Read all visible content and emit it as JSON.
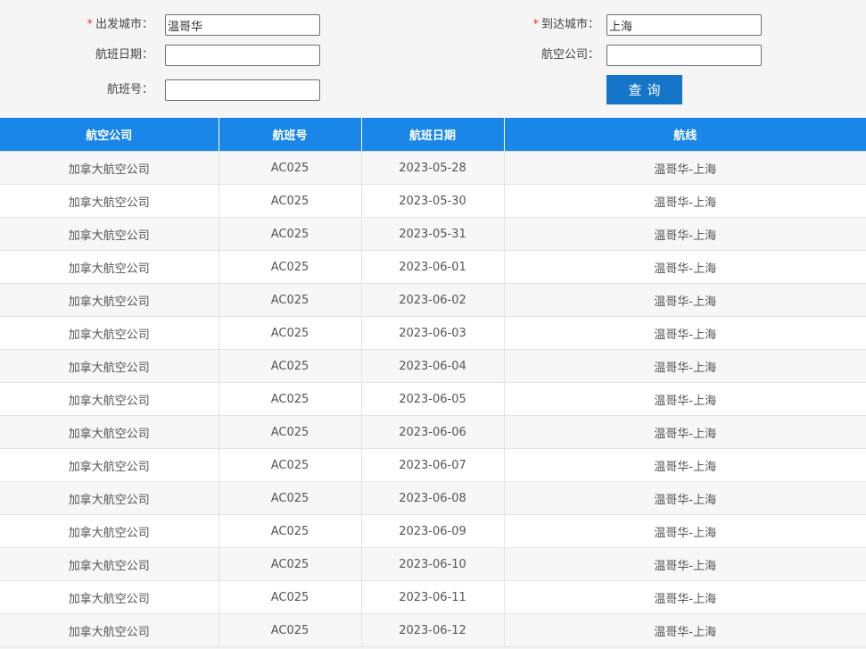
{
  "form": {
    "required_mark": "*",
    "origin": {
      "label": "出发城市：",
      "value": "温哥华"
    },
    "destination": {
      "label": "到达城市：",
      "value": "上海"
    },
    "flight_date": {
      "label": "航班日期：",
      "value": ""
    },
    "airline": {
      "label": "航空公司：",
      "value": ""
    },
    "flight_number": {
      "label": "航班号：",
      "value": ""
    },
    "query_button": "查询"
  },
  "table": {
    "headers": [
      "航空公司",
      "航班号",
      "航班日期",
      "航线"
    ],
    "rows": [
      [
        "加拿大航空公司",
        "AC025",
        "2023-05-28",
        "温哥华-上海"
      ],
      [
        "加拿大航空公司",
        "AC025",
        "2023-05-30",
        "温哥华-上海"
      ],
      [
        "加拿大航空公司",
        "AC025",
        "2023-05-31",
        "温哥华-上海"
      ],
      [
        "加拿大航空公司",
        "AC025",
        "2023-06-01",
        "温哥华-上海"
      ],
      [
        "加拿大航空公司",
        "AC025",
        "2023-06-02",
        "温哥华-上海"
      ],
      [
        "加拿大航空公司",
        "AC025",
        "2023-06-03",
        "温哥华-上海"
      ],
      [
        "加拿大航空公司",
        "AC025",
        "2023-06-04",
        "温哥华-上海"
      ],
      [
        "加拿大航空公司",
        "AC025",
        "2023-06-05",
        "温哥华-上海"
      ],
      [
        "加拿大航空公司",
        "AC025",
        "2023-06-06",
        "温哥华-上海"
      ],
      [
        "加拿大航空公司",
        "AC025",
        "2023-06-07",
        "温哥华-上海"
      ],
      [
        "加拿大航空公司",
        "AC025",
        "2023-06-08",
        "温哥华-上海"
      ],
      [
        "加拿大航空公司",
        "AC025",
        "2023-06-09",
        "温哥华-上海"
      ],
      [
        "加拿大航空公司",
        "AC025",
        "2023-06-10",
        "温哥华-上海"
      ],
      [
        "加拿大航空公司",
        "AC025",
        "2023-06-11",
        "温哥华-上海"
      ],
      [
        "加拿大航空公司",
        "AC025",
        "2023-06-12",
        "温哥华-上海"
      ]
    ]
  }
}
